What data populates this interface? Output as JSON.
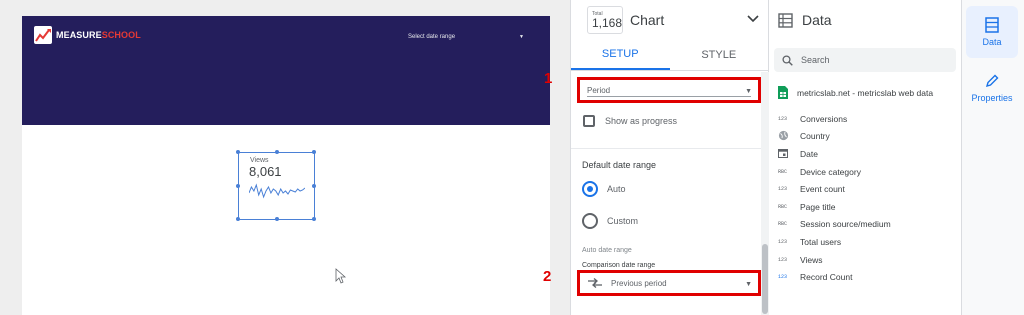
{
  "report": {
    "logo_text_primary": "MEASURE",
    "logo_text_secondary": "SCHOOL",
    "date_range_select": "Select date range",
    "scorecard": {
      "label": "Views",
      "value": "8,061",
      "sparkline": [
        0.4,
        0.7,
        0.5,
        0.8,
        0.3,
        0.6,
        0.2,
        0.5,
        0.7,
        0.4,
        0.6,
        0.5,
        0.3,
        0.6,
        0.4,
        0.5,
        0.35,
        0.55,
        0.5,
        0.45,
        0.6,
        0.5,
        0.55,
        0.65
      ]
    },
    "header_color": "#241e5c"
  },
  "chart_panel": {
    "type_icon_caption": "Total",
    "type_icon_value": "1,168",
    "title": "Chart",
    "tabs": [
      {
        "label": "SETUP",
        "active": true
      },
      {
        "label": "STYLE",
        "active": false
      }
    ],
    "comparison_field_value": "Period",
    "show_as_progress": "Show as progress",
    "default_date_range_label": "Default date range",
    "radio_auto": "Auto",
    "radio_custom": "Custom",
    "auto_date_range_note": "Auto date range",
    "comparison_date_range_label": "Comparison date range",
    "comparison_period_value": "Previous period"
  },
  "callouts": {
    "badge_1": "1",
    "badge_2": "2",
    "highlight_color": "#e00000"
  },
  "data_panel": {
    "title": "Data",
    "search_placeholder": "Search",
    "data_source": "metricslab.net - metricslab web data",
    "fields": [
      {
        "type": "123",
        "name": "Conversions",
        "kind": "metric"
      },
      {
        "type": "globe",
        "name": "Country",
        "kind": "dimension"
      },
      {
        "type": "calendar",
        "name": "Date",
        "kind": "dimension"
      },
      {
        "type": "RBC",
        "name": "Device category",
        "kind": "dimension"
      },
      {
        "type": "123",
        "name": "Event count",
        "kind": "metric"
      },
      {
        "type": "RBC",
        "name": "Page title",
        "kind": "dimension"
      },
      {
        "type": "RBC",
        "name": "Session source/medium",
        "kind": "dimension"
      },
      {
        "type": "123",
        "name": "Total users",
        "kind": "metric"
      },
      {
        "type": "123",
        "name": "Views",
        "kind": "metric"
      },
      {
        "type": "123",
        "name": "Record Count",
        "kind": "metric-blue"
      }
    ]
  },
  "right_rail": {
    "data_label": "Data",
    "properties_label": "Properties",
    "accent": "#1a73e8"
  }
}
